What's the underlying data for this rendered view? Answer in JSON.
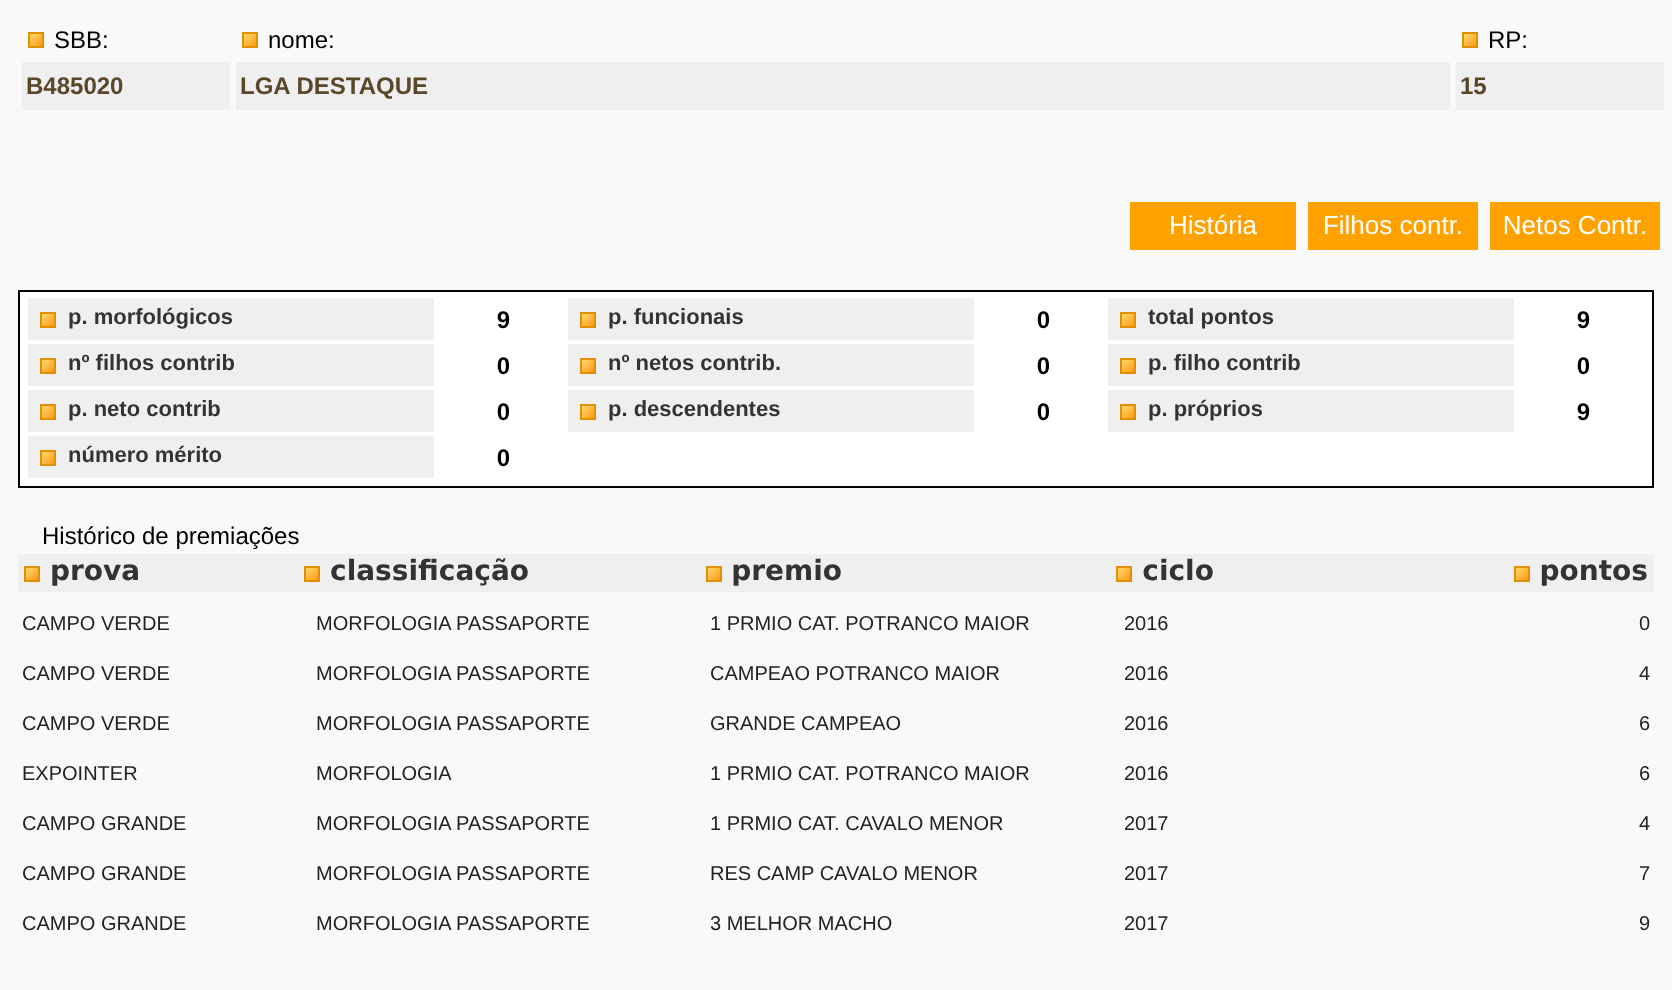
{
  "fields": [
    {
      "label": "SBB:",
      "value": "B485020"
    },
    {
      "label": "nome:",
      "value": "LGA DESTAQUE"
    },
    {
      "label": "RP:",
      "value": "15"
    }
  ],
  "buttons": [
    "História",
    "Filhos contr.",
    "Netos Contr."
  ],
  "stats": [
    [
      {
        "label": "p. morfológicos",
        "value": "9"
      },
      {
        "label": "nº filhos contrib",
        "value": "0"
      },
      {
        "label": "p. neto contrib",
        "value": "0"
      },
      {
        "label": "número mérito",
        "value": "0"
      }
    ],
    [
      {
        "label": "p. funcionais",
        "value": "0"
      },
      {
        "label": "nº netos contrib.",
        "value": "0"
      },
      {
        "label": "p. descendentes",
        "value": "0"
      }
    ],
    [
      {
        "label": "total pontos",
        "value": "9"
      },
      {
        "label": "p. filho contrib",
        "value": "0"
      },
      {
        "label": "p. próprios",
        "value": "9"
      }
    ]
  ],
  "awards": {
    "title": "Histórico de premiações",
    "columns": [
      "prova",
      "classificação",
      "premio",
      "ciclo",
      "pontos"
    ],
    "rows": [
      [
        "CAMPO VERDE",
        "MORFOLOGIA PASSAPORTE",
        "1 PRMIO CAT. POTRANCO MAIOR",
        "2016",
        "0"
      ],
      [
        "CAMPO VERDE",
        "MORFOLOGIA PASSAPORTE",
        "CAMPEAO POTRANCO MAIOR",
        "2016",
        "4"
      ],
      [
        "CAMPO VERDE",
        "MORFOLOGIA PASSAPORTE",
        "GRANDE CAMPEAO",
        "2016",
        "6"
      ],
      [
        "EXPOINTER",
        "MORFOLOGIA",
        "1 PRMIO CAT. POTRANCO MAIOR",
        "2016",
        "6"
      ],
      [
        "CAMPO GRANDE",
        "MORFOLOGIA PASSAPORTE",
        "1 PRMIO CAT. CAVALO MENOR",
        "2017",
        "4"
      ],
      [
        "CAMPO GRANDE",
        "MORFOLOGIA PASSAPORTE",
        "RES CAMP CAVALO MENOR",
        "2017",
        "7"
      ],
      [
        "CAMPO GRANDE",
        "MORFOLOGIA PASSAPORTE",
        "3 MELHOR MACHO",
        "2017",
        "9"
      ]
    ]
  }
}
